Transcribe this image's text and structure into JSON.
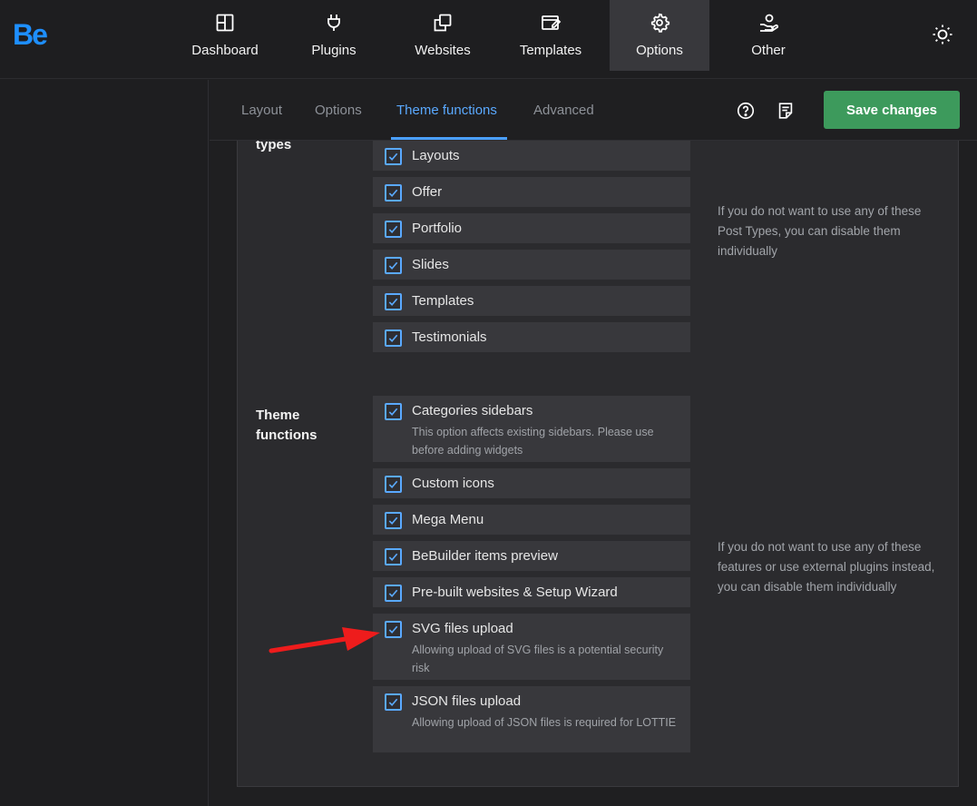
{
  "brand": {
    "logo_text": "Be",
    "logo_color": "#1e8fff"
  },
  "topnav": {
    "items": [
      {
        "label": "Dashboard",
        "icon": "grid-icon"
      },
      {
        "label": "Plugins",
        "icon": "plug-icon"
      },
      {
        "label": "Websites",
        "icon": "copy-icon"
      },
      {
        "label": "Templates",
        "icon": "template-edit-icon"
      },
      {
        "label": "Options",
        "icon": "gear-icon",
        "active": true
      },
      {
        "label": "Other",
        "icon": "hand-user-icon"
      }
    ],
    "theme_toggle_icon": "sun-icon"
  },
  "subnav": {
    "tabs": [
      {
        "label": "Layout"
      },
      {
        "label": "Options"
      },
      {
        "label": "Theme functions",
        "active": true
      },
      {
        "label": "Advanced"
      }
    ],
    "help_icon": "question-circle-icon",
    "notes_icon": "notes-icon",
    "save_label": "Save changes"
  },
  "post_types": {
    "label": "types",
    "description": "If you do not want to use any of these Post Types, you can disable them individually",
    "items": [
      {
        "label": "Layouts",
        "checked": true
      },
      {
        "label": "Offer",
        "checked": true
      },
      {
        "label": "Portfolio",
        "checked": true
      },
      {
        "label": "Slides",
        "checked": true
      },
      {
        "label": "Templates",
        "checked": true
      },
      {
        "label": "Testimonials",
        "checked": true
      }
    ]
  },
  "theme_functions": {
    "label_line1": "Theme",
    "label_line2": "functions",
    "description": "If you do not want to use any of these features or use external plugins instead, you can disable them individually",
    "items": [
      {
        "label": "Categories sidebars",
        "sub": "This option affects existing sidebars. Please use before adding widgets",
        "checked": true
      },
      {
        "label": "Custom icons",
        "checked": true
      },
      {
        "label": "Mega Menu",
        "checked": true
      },
      {
        "label": "BeBuilder items preview",
        "checked": true
      },
      {
        "label": "Pre-built websites & Setup Wizard",
        "checked": true
      },
      {
        "label": "SVG files upload",
        "sub": "Allowing upload of SVG files is a potential security risk",
        "checked": true
      },
      {
        "label": "JSON files upload",
        "sub": "Allowing upload of JSON files is required for LOTTIE",
        "checked": true
      }
    ]
  },
  "colors": {
    "accent": "#5aa9ff",
    "save": "#3d9a5c",
    "annotation_arrow": "#ee1c1c"
  }
}
